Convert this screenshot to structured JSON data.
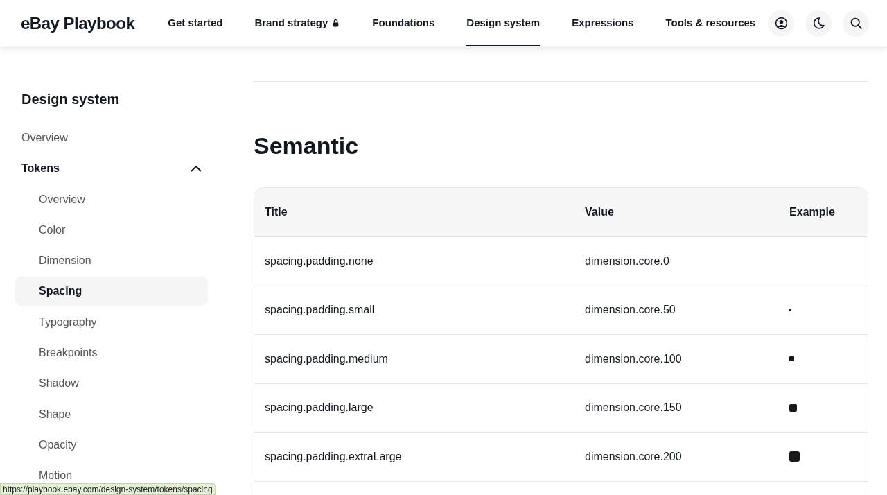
{
  "header": {
    "logo": "eBay Playbook",
    "nav": [
      {
        "label": "Get started",
        "selected": false,
        "locked": false
      },
      {
        "label": "Brand strategy",
        "selected": false,
        "locked": true
      },
      {
        "label": "Foundations",
        "selected": false,
        "locked": false
      },
      {
        "label": "Design system",
        "selected": true,
        "locked": false
      },
      {
        "label": "Expressions",
        "selected": false,
        "locked": false
      },
      {
        "label": "Tools & resources",
        "selected": false,
        "locked": false
      }
    ],
    "actions": [
      {
        "kind": "account"
      },
      {
        "kind": "theme"
      },
      {
        "kind": "search"
      }
    ]
  },
  "sidebar": {
    "title": "Design system",
    "items": [
      {
        "label": "Overview",
        "selected": false
      },
      {
        "label": "Tokens",
        "expanded": true,
        "children": [
          {
            "label": "Overview",
            "selected": false
          },
          {
            "label": "Color",
            "selected": false
          },
          {
            "label": "Dimension",
            "selected": false
          },
          {
            "label": "Spacing",
            "selected": true
          },
          {
            "label": "Typography",
            "selected": false
          },
          {
            "label": "Breakpoints",
            "selected": false
          },
          {
            "label": "Shadow",
            "selected": false
          },
          {
            "label": "Shape",
            "selected": false
          },
          {
            "label": "Opacity",
            "selected": false
          },
          {
            "label": "Motion",
            "selected": false
          }
        ]
      }
    ]
  },
  "section": {
    "title": "Semantic",
    "table": {
      "columns": [
        "Title",
        "Value",
        "Example"
      ],
      "rows": [
        {
          "title": "spacing.padding.none",
          "value": "dimension.core.0",
          "kind": "none"
        },
        {
          "title": "spacing.padding.small",
          "value": "dimension.core.50",
          "kind": "small"
        },
        {
          "title": "spacing.padding.medium",
          "value": "dimension.core.100",
          "kind": "medium"
        },
        {
          "title": "spacing.padding.large",
          "value": "dimension.core.150",
          "kind": "large"
        },
        {
          "title": "spacing.padding.extraLarge",
          "value": "dimension.core.200",
          "kind": "extralarge"
        }
      ]
    }
  },
  "status_bar": {
    "url": "https://playbook.ebay.com/design-system/tokens/spacing"
  }
}
